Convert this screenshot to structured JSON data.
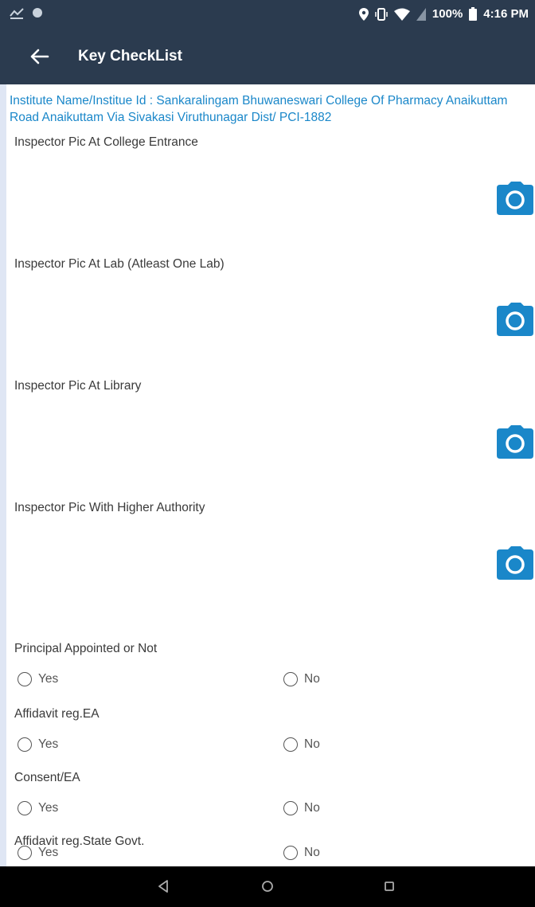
{
  "status": {
    "battery": "100%",
    "time": "4:16 PM"
  },
  "appbar": {
    "title": "Key CheckList"
  },
  "institute_info": "Institute Name/Institue Id : Sankaralingam Bhuwaneswari College Of Pharmacy Anaikuttam Road Anaikuttam Via Sivakasi Viruthunagar Dist/ PCI-1882",
  "photo_sections": [
    {
      "label": "Inspector Pic At College Entrance"
    },
    {
      "label": "Inspector Pic At Lab (Atleast One Lab)"
    },
    {
      "label": "Inspector Pic At Library"
    },
    {
      "label": "Inspector Pic With Higher Authority"
    }
  ],
  "questions": [
    {
      "label": "Principal Appointed or Not",
      "yes": "Yes",
      "no": "No"
    },
    {
      "label": "Affidavit reg.EA",
      "yes": "Yes",
      "no": "No"
    },
    {
      "label": "Consent/EA",
      "yes": "Yes",
      "no": "No"
    },
    {
      "label": "Affidavit reg.State Govt.",
      "yes": "Yes",
      "no": "No"
    }
  ],
  "colors": {
    "header_bg": "#2b3b4f",
    "accent_blue": "#1a87c9",
    "page_bg": "#dfe6f4"
  },
  "icons": {
    "back": "arrow-left-icon",
    "camera": "camera-icon",
    "nav_back": "triangle-back-icon",
    "nav_home": "circle-home-icon",
    "nav_recent": "square-recent-icon"
  }
}
